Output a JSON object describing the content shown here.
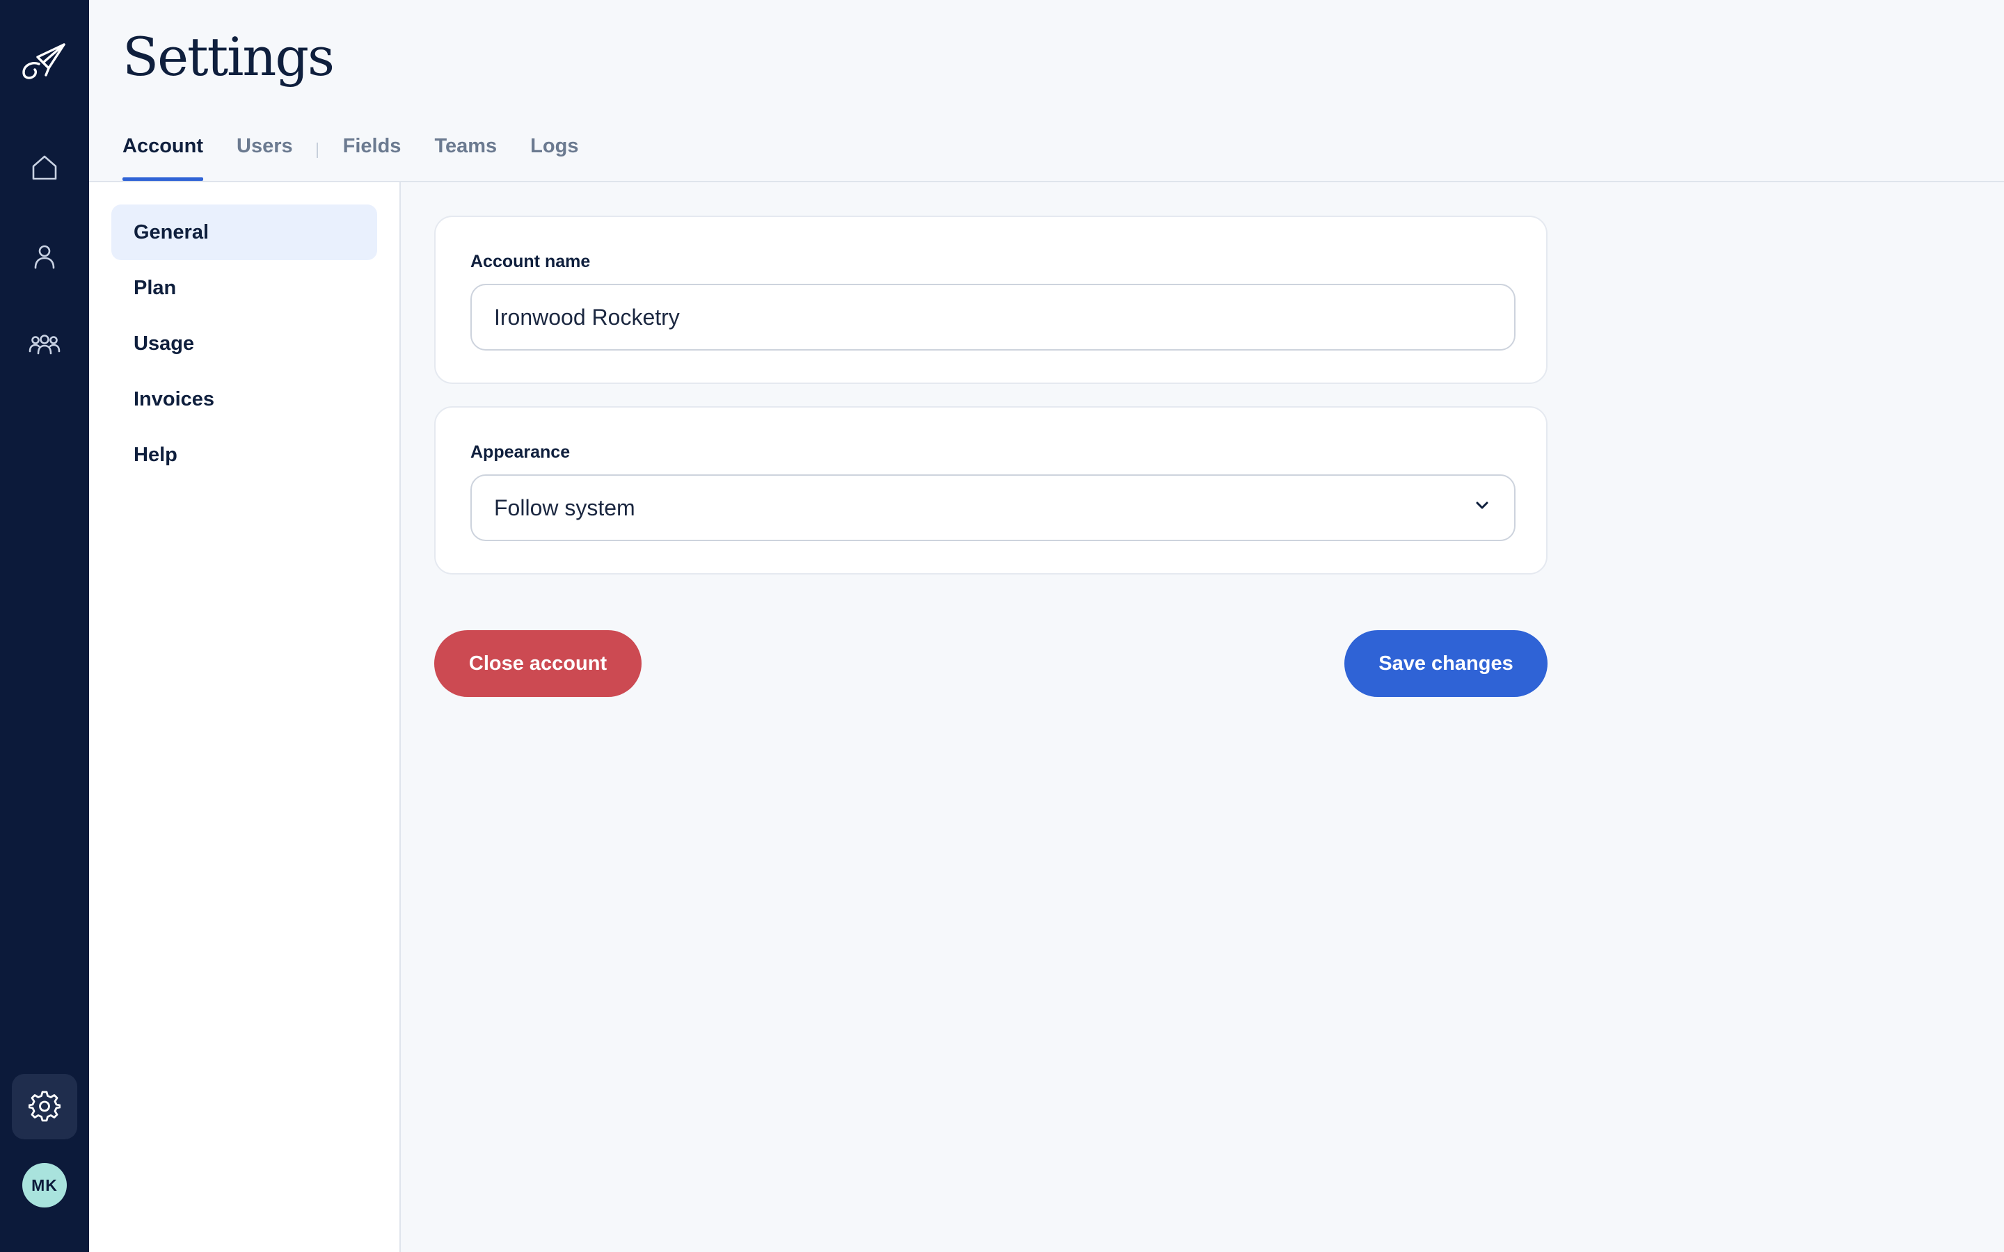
{
  "header": {
    "title": "Settings"
  },
  "tabs": [
    {
      "label": "Account",
      "active": true
    },
    {
      "label": "Users",
      "active": false
    },
    {
      "label": "Fields",
      "active": false
    },
    {
      "label": "Teams",
      "active": false
    },
    {
      "label": "Logs",
      "active": false
    }
  ],
  "rail": {
    "icons": [
      "logo-paper-plane-icon",
      "home-icon",
      "user-icon",
      "team-icon",
      "gear-icon"
    ],
    "active": "gear-icon",
    "avatar_initials": "MK"
  },
  "subnav": {
    "items": [
      {
        "label": "General",
        "active": true
      },
      {
        "label": "Plan",
        "active": false
      },
      {
        "label": "Usage",
        "active": false
      },
      {
        "label": "Invoices",
        "active": false
      },
      {
        "label": "Help",
        "active": false
      }
    ]
  },
  "account_card": {
    "label": "Account name",
    "value": "Ironwood Rocketry"
  },
  "appearance_card": {
    "label": "Appearance",
    "selected": "Follow system"
  },
  "actions": {
    "close_label": "Close account",
    "save_label": "Save changes"
  },
  "colors": {
    "rail_bg": "#0c1a3a",
    "accent": "#2f63d6",
    "danger": "#cc4a52",
    "avatar_bg": "#a9e3dd"
  }
}
